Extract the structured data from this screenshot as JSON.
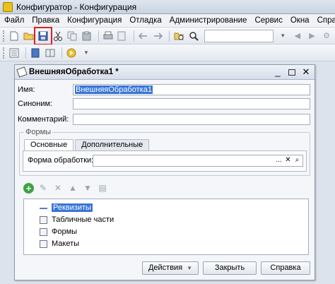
{
  "window": {
    "title": "Конфигуратор - Конфигурация"
  },
  "menu": [
    "Файл",
    "Правка",
    "Конфигурация",
    "Отладка",
    "Администрирование",
    "Сервис",
    "Окна",
    "Справка"
  ],
  "toolbar1": {
    "icons": [
      "new-icon",
      "open-icon",
      "save-icon",
      "cut-icon",
      "copy-icon",
      "paste-icon",
      "print-icon",
      "preview-icon",
      "undo-icon",
      "redo-icon",
      "find-icon",
      "search-icon"
    ],
    "highlight_color": "#e0201c"
  },
  "child": {
    "title": "ВнешняяОбработка1 *",
    "fields": {
      "name_label": "Имя:",
      "name_value": "ВнешняяОбработка1",
      "synonym_label": "Синоним:",
      "synonym_value": "",
      "comment_label": "Комментарий:",
      "comment_value": ""
    },
    "forms_group": {
      "title": "Формы",
      "tabs": [
        "Основные",
        "Дополнительные"
      ],
      "form_label": "Форма обработки:",
      "form_value": "",
      "btn_select": "...",
      "btn_clear": "✕",
      "btn_open": "🔍"
    },
    "tree": {
      "items": [
        "Реквизиты",
        "Табличные части",
        "Формы",
        "Макеты"
      ],
      "selected": "Реквизиты"
    },
    "buttons": {
      "actions": "Действия",
      "close": "Закрыть",
      "help": "Справка"
    }
  },
  "colors": {
    "selection": "#3875d7",
    "accent": "#e0201c"
  }
}
